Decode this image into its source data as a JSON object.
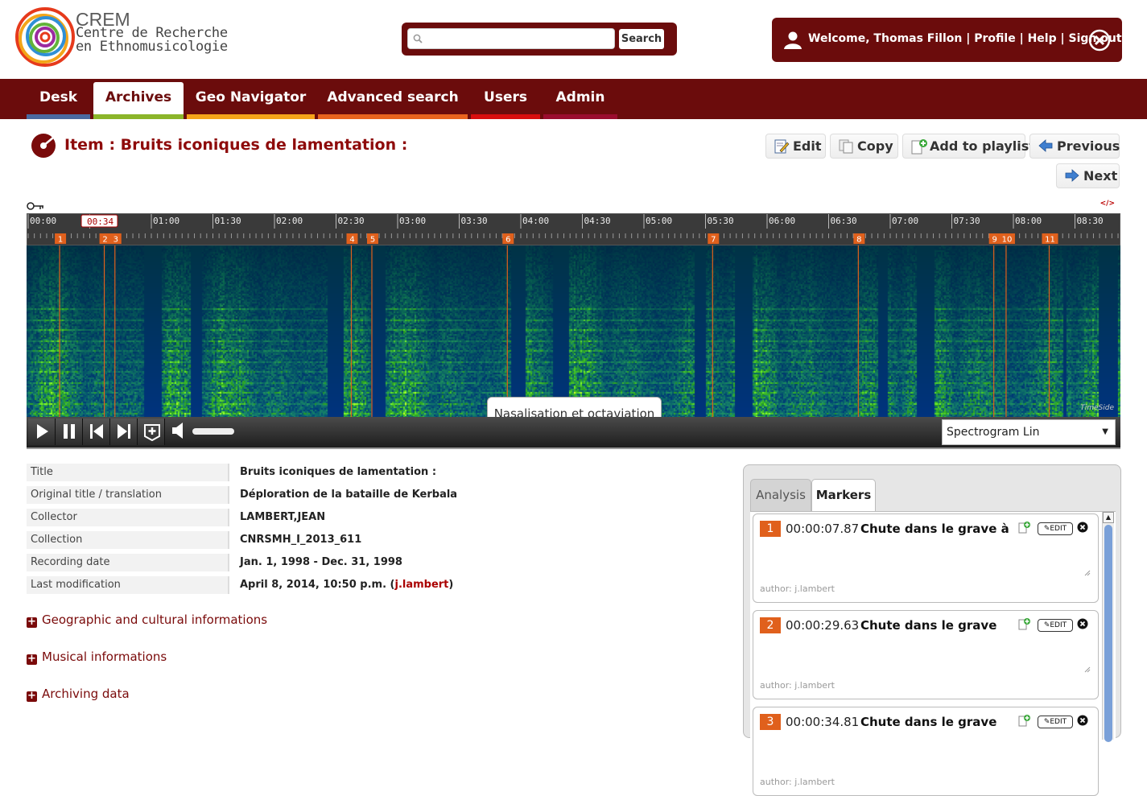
{
  "logo": {
    "line1": "CREM",
    "line2": "Centre de Recherche",
    "line3": "en Ethnomusicologie"
  },
  "search": {
    "value": "",
    "placeholder": "",
    "button": "Search"
  },
  "user": {
    "welcome": "Welcome, Thomas Fillon",
    "profile": "Profile",
    "help": "Help",
    "signout": "Sign out"
  },
  "nav": [
    {
      "label": "Desk",
      "color": "#4a6aa0"
    },
    {
      "label": "Archives",
      "color": "#8bb52a",
      "active": true
    },
    {
      "label": "Geo Navigator",
      "color": "#f5a31a"
    },
    {
      "label": "Advanced search",
      "color": "#e8641e"
    },
    {
      "label": "Users",
      "color": "#d80e0e"
    },
    {
      "label": "Admin",
      "color": "#9a0d2e"
    }
  ],
  "item": {
    "prefix": "Item : ",
    "title": "Bruits iconiques de lamentation :"
  },
  "toolbar": {
    "edit": "Edit",
    "copy": "Copy",
    "add_playlist": "Add to playlist",
    "previous": "Previous",
    "next": "Next"
  },
  "player": {
    "embed": "</>",
    "current_time": "00:34",
    "ticks": [
      "00:00",
      "00:30",
      "01:00",
      "01:30",
      "02:00",
      "02:30",
      "03:00",
      "03:30",
      "04:00",
      "04:30",
      "05:00",
      "05:30",
      "06:00",
      "06:30",
      "07:00",
      "07:30",
      "08:00",
      "08:30"
    ],
    "markers": [
      "1",
      "2",
      "3",
      "4",
      "5",
      "6",
      "7",
      "8",
      "9",
      "10",
      "11"
    ],
    "tooltip": "Nasalisation et octaviation",
    "view": "Spectrogram Lin",
    "watermark": "TimeSide"
  },
  "metadata": [
    {
      "key": "Title",
      "value": "Bruits iconiques de lamentation :"
    },
    {
      "key": "Original title / translation",
      "value": "Déploration de la bataille de Kerbala"
    },
    {
      "key": "Collector",
      "value": "LAMBERT,JEAN"
    },
    {
      "key": "Collection",
      "value": "CNRSMH_I_2013_611",
      "link": true
    },
    {
      "key": "Recording date",
      "value": "Jan. 1, 1998 - Dec. 31, 1998"
    },
    {
      "key": "Last modification",
      "value": "April 8, 2014, 10:50 p.m. (",
      "author": "j.lambert",
      "close": ")"
    }
  ],
  "sections": [
    "Geographic and cultural informations",
    "Musical informations",
    "Archiving data"
  ],
  "panel": {
    "tabs": [
      "Analysis",
      "Markers"
    ],
    "markers": [
      {
        "num": "1",
        "time": "00:00:07.87",
        "title": "Chute dans le grave à la fin",
        "edit": "EDIT",
        "author": "author: j.lambert"
      },
      {
        "num": "2",
        "time": "00:00:29.63",
        "title": "Chute dans le grave",
        "edit": "EDIT",
        "author": "author: j.lambert"
      },
      {
        "num": "3",
        "time": "00:00:34.81",
        "title": "Chute dans le grave",
        "edit": "EDIT",
        "author": "author: j.lambert"
      }
    ]
  }
}
